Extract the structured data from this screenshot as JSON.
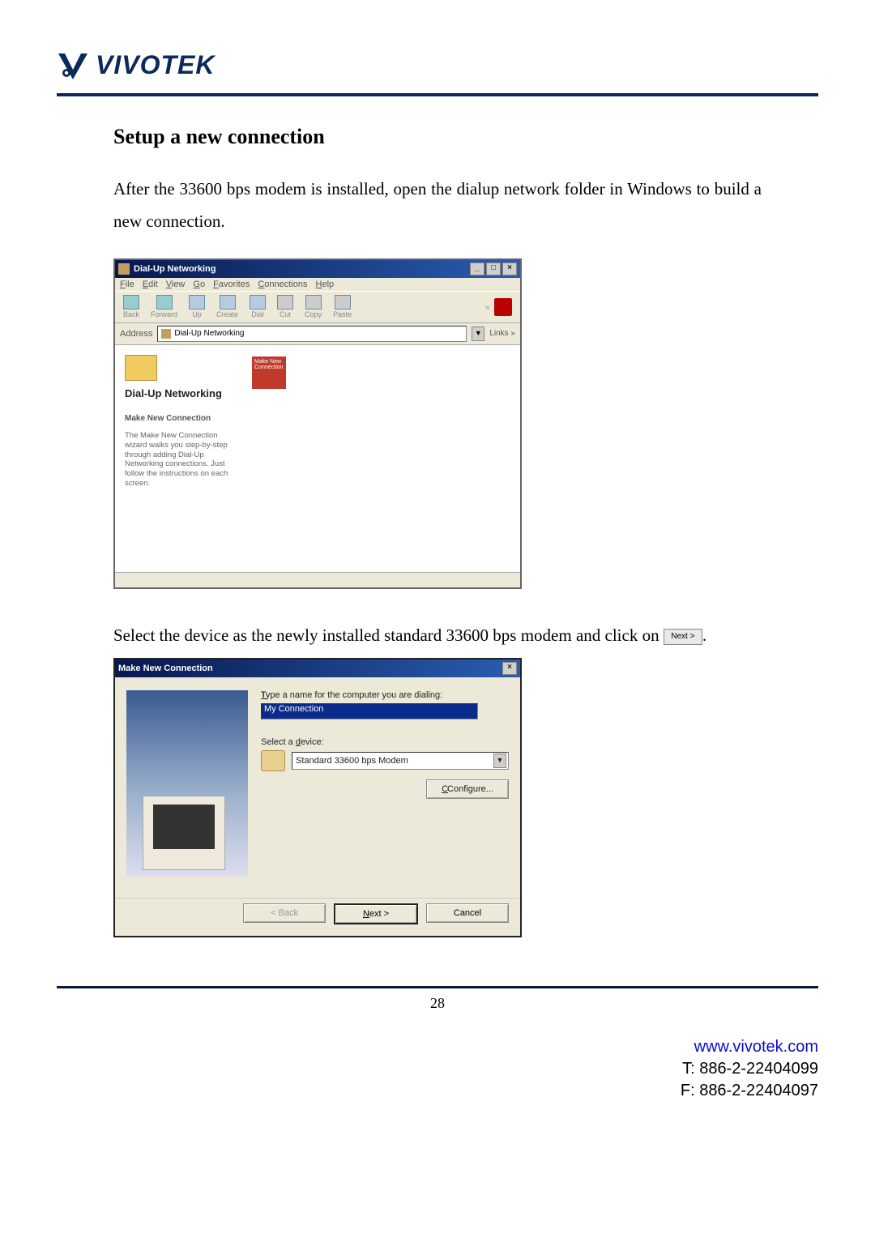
{
  "brand": {
    "name": "VIVOTEK"
  },
  "heading": "Setup a new connection",
  "para1": "After the 33600 bps modem is installed, open the dialup network folder in Windows to build a new connection.",
  "para2_a": "Select the device as the newly installed standard 33600 bps modem and click on ",
  "para2_btn": "Next >",
  "para2_b": ".",
  "win1": {
    "title": "Dial-Up Networking",
    "menus": [
      "File",
      "Edit",
      "View",
      "Go",
      "Favorites",
      "Connections",
      "Help"
    ],
    "toolbar": [
      "Back",
      "Forward",
      "Up",
      "Create",
      "Dial",
      "Cut",
      "Copy",
      "Paste"
    ],
    "address_label": "Address",
    "address_value": "Dial-Up Networking",
    "links_label": "Links »",
    "side_title": "Dial-Up Networking",
    "side_subtitle": "Make New Connection",
    "side_desc": "The Make New Connection wizard walks you step-by-step through adding Dial-Up Networking connections. Just follow the instructions on each screen.",
    "selected_icon": "Make New Connection"
  },
  "win2": {
    "title": "Make New Connection",
    "label_name": "Type a name for the computer you are dialing:",
    "name_value": "My Connection",
    "label_device": "Select a device:",
    "device_value": "Standard 33600 bps Modem",
    "btn_configure": "Configure...",
    "btn_back": "< Back",
    "btn_next": "Next >",
    "btn_cancel": "Cancel"
  },
  "page_number": "28",
  "footer": {
    "url": "www.vivotek.com",
    "tel": "T: 886-2-22404099",
    "fax": "F: 886-2-22404097"
  }
}
